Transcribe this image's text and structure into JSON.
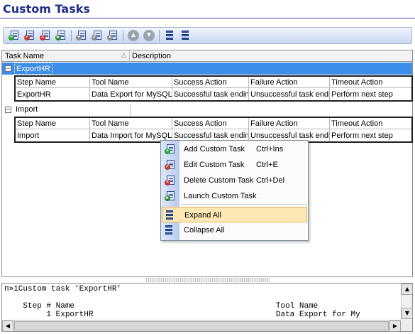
{
  "title": "Custom Tasks",
  "toolbar": {
    "buttons": [
      {
        "name": "add-custom-task-button",
        "icon": "add-task-icon",
        "badge": "+",
        "badge_class": "b-add"
      },
      {
        "name": "edit-custom-task-button",
        "icon": "edit-task-icon",
        "badge": "✓",
        "badge_class": "b-edit"
      },
      {
        "name": "delete-custom-task-button",
        "icon": "delete-task-icon",
        "badge": "×",
        "badge_class": "b-del"
      },
      {
        "name": "launch-custom-task-button",
        "icon": "launch-task-icon",
        "badge": "►",
        "badge_class": "b-run"
      },
      {
        "sep": true
      },
      {
        "name": "add-step-button",
        "icon": "add-step-icon",
        "badge": "+",
        "badge_class": "b-grey"
      },
      {
        "name": "edit-step-button",
        "icon": "edit-step-icon",
        "badge": "✓",
        "badge_class": "b-grey"
      },
      {
        "name": "delete-step-button",
        "icon": "delete-step-icon",
        "badge": "×",
        "badge_class": "b-grey"
      },
      {
        "sep": true
      },
      {
        "name": "move-up-button",
        "icon": "arrow-up-icon",
        "glyph": "▲"
      },
      {
        "name": "move-down-button",
        "icon": "arrow-down-icon",
        "glyph": "▼"
      },
      {
        "sep": true
      },
      {
        "name": "expand-all-button",
        "icon": "expand-all-icon",
        "tree": true
      },
      {
        "name": "collapse-all-button",
        "icon": "collapse-all-icon",
        "tree": true
      }
    ]
  },
  "grid": {
    "columns": [
      "Task Name",
      "Description"
    ],
    "sort_indicator": "△",
    "detail_columns": [
      "Step Name",
      "Tool Name",
      "Success Action",
      "Failure Action",
      "Timeout Action"
    ],
    "groups": [
      {
        "name": "ExportHR",
        "expand_glyph": "−",
        "selected": true,
        "steps": [
          [
            "ExportHR",
            "Data Export for MySQL",
            "Successful task ending",
            "Unsuccessful task ending",
            "Perform next step"
          ]
        ]
      },
      {
        "name": "Import",
        "expand_glyph": "−",
        "selected": false,
        "steps": [
          [
            "Import",
            "Data Import for MySQL",
            "Successful task ending",
            "Unsuccessful task ending",
            "Perform next step"
          ]
        ]
      }
    ]
  },
  "context_menu": {
    "items": [
      {
        "label": "Add Custom Task",
        "shortcut": "Ctrl+Ins",
        "icon": "add-task-icon",
        "badge": "+",
        "badge_class": "b-add"
      },
      {
        "label": "Edit Custom Task",
        "shortcut": "Ctrl+E",
        "icon": "edit-task-icon",
        "badge": "✓",
        "badge_class": "b-edit"
      },
      {
        "label": "Delete Custom Task",
        "shortcut": "Ctrl+Del",
        "icon": "delete-task-icon",
        "badge": "×",
        "badge_class": "b-del"
      },
      {
        "label": "Launch Custom Task",
        "shortcut": "",
        "icon": "launch-task-icon",
        "badge": "►",
        "badge_class": "b-run"
      },
      {
        "label": "Expand All",
        "shortcut": "",
        "icon": "expand-all-icon",
        "highlighted": true
      },
      {
        "label": "Collapse All",
        "shortcut": "",
        "icon": "collapse-all-icon"
      }
    ]
  },
  "log": {
    "lines": [
      "п»їCustom task 'ExportHR'",
      "",
      "    Step # Name                                           Tool Name",
      "         1 ExportHR                                       Data Export for My"
    ]
  },
  "colors": {
    "title": "#1f2f8a",
    "selection": "#3d8ee6",
    "menu_highlight": "#fde7b5"
  }
}
